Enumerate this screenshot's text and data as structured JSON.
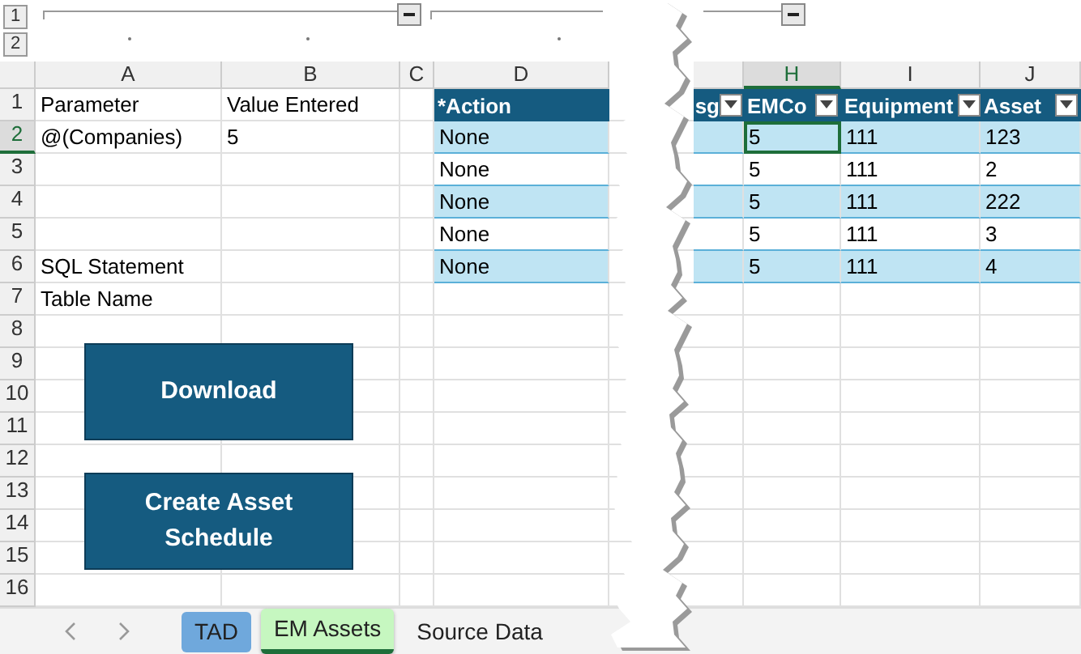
{
  "outline": {
    "levels": [
      "1",
      "2"
    ]
  },
  "column_headers": [
    {
      "label": "A",
      "selected": false
    },
    {
      "label": "B",
      "selected": false
    },
    {
      "label": "C",
      "selected": false
    },
    {
      "label": "D",
      "selected": false
    },
    {
      "selected": false
    },
    {
      "label": "H",
      "selected": true
    },
    {
      "label": "I",
      "selected": false
    },
    {
      "label": "J",
      "selected": false
    }
  ],
  "row_numbers": [
    {
      "label": "1",
      "selected": false
    },
    {
      "label": "2",
      "selected": true
    },
    {
      "label": "3",
      "selected": false
    },
    {
      "label": "4",
      "selected": false
    },
    {
      "label": "5",
      "selected": false
    },
    {
      "label": "6",
      "selected": false
    },
    {
      "label": "7",
      "selected": false
    },
    {
      "label": "8",
      "selected": false
    },
    {
      "label": "9",
      "selected": false
    },
    {
      "label": "10",
      "selected": false
    },
    {
      "label": "11",
      "selected": false
    },
    {
      "label": "12",
      "selected": false
    },
    {
      "label": "13",
      "selected": false
    },
    {
      "label": "14",
      "selected": false
    },
    {
      "label": "15",
      "selected": false
    },
    {
      "label": "16",
      "selected": false
    }
  ],
  "parameter_cells": [
    {
      "a": "Parameter",
      "b": "Value Entered"
    },
    {
      "a": "@(Companies)",
      "b": "5"
    },
    {},
    {},
    {},
    {
      "a": "SQL Statement"
    },
    {
      "a": "Table Name"
    }
  ],
  "data_table": {
    "columns": [
      {
        "label": "*Action",
        "filter": false
      },
      {
        "label": "sg",
        "filter": true
      },
      {
        "label": "EMCo",
        "filter": true
      },
      {
        "label": "Equipment",
        "filter": true
      },
      {
        "label": "Asset",
        "filter": true
      }
    ],
    "rows": [
      {
        "action": "None",
        "emco": "5",
        "equipment": "111",
        "asset": "123",
        "active": true
      },
      {
        "action": "None",
        "emco": "5",
        "equipment": "111",
        "asset": "2",
        "active": false
      },
      {
        "action": "None",
        "emco": "5",
        "equipment": "111",
        "asset": "222",
        "active": false
      },
      {
        "action": "None",
        "emco": "5",
        "equipment": "111",
        "asset": "3",
        "active": false
      },
      {
        "action": "None",
        "emco": "5",
        "equipment": "111",
        "asset": "4",
        "active": false
      }
    ]
  },
  "buttons": [
    "Download",
    "Create Asset Schedule"
  ],
  "sheet_tabs": [
    {
      "label": "TAD",
      "selected": false,
      "color": "#6fa8dc"
    },
    {
      "label": "EM Assets",
      "selected": true,
      "color": "#c6f7c0"
    },
    {
      "label": "Source Data",
      "selected": false
    }
  ]
}
